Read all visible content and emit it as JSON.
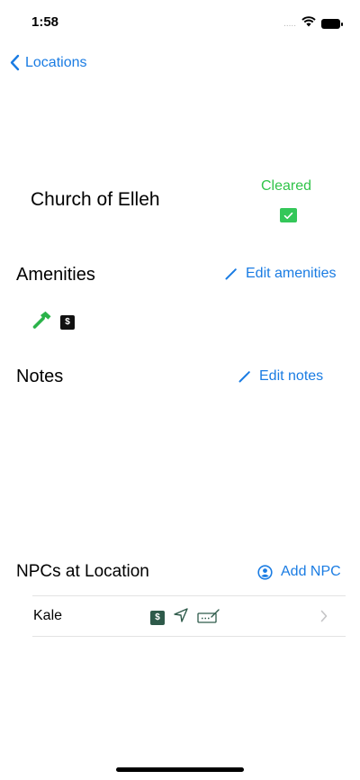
{
  "status_bar": {
    "time": "1:58",
    "signal": "....."
  },
  "nav": {
    "back_label": "Locations"
  },
  "location": {
    "name": "Church of Elleh",
    "status": "Cleared"
  },
  "amenities": {
    "title": "Amenities",
    "edit_label": "Edit amenities",
    "items": [
      {
        "icon": "hammer-icon"
      },
      {
        "icon": "dollar-icon",
        "text": "$"
      }
    ]
  },
  "notes": {
    "title": "Notes",
    "edit_label": "Edit notes"
  },
  "npcs": {
    "title": "NPCs at Location",
    "add_label": "Add NPC",
    "items": [
      {
        "name": "Kale",
        "icons": [
          "dollar-icon",
          "location-arrow-icon",
          "signature-icon"
        ],
        "dollar_text": "$"
      }
    ]
  },
  "colors": {
    "accent": "#1a7ce3",
    "status_green": "#31c44a",
    "checkbox_green": "#34c759",
    "hammer_green": "#2bb34a"
  }
}
